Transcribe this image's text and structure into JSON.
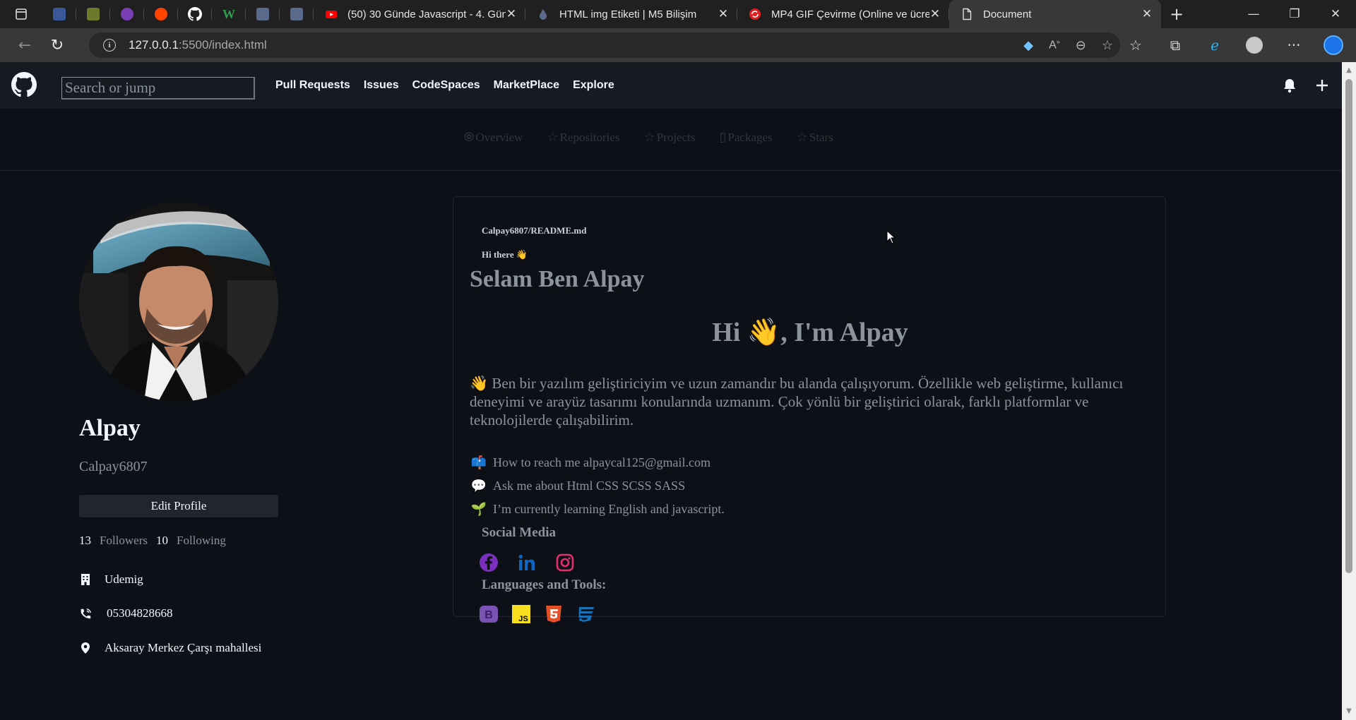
{
  "browser": {
    "tabs": [
      {
        "title": "(50) 30 Günde Javascript - 4. Gün"
      },
      {
        "title": "HTML img Etiketi | M5 Bilişim"
      },
      {
        "title": "MP4 GIF Çevirme (Online ve ücre"
      },
      {
        "title": "Document"
      }
    ],
    "url_host": "127.0.0.1",
    "url_rest": ":5500/index.html"
  },
  "header": {
    "search_placeholder": "Search or jump",
    "nav": [
      "Pull Requests",
      "Issues",
      "CodeSpaces",
      "MarketPlace",
      "Explore"
    ]
  },
  "profile_tabs": [
    "Overview",
    "Repositories",
    "Projects",
    "Packages",
    "Stars"
  ],
  "profile": {
    "name": "Alpay",
    "username": "Calpay6807",
    "edit_label": "Edit Profile",
    "followers_count": "13",
    "followers_label": "Followers",
    "following_count": "10",
    "following_label": "Following",
    "company": "Udemig",
    "phone": "05304828668",
    "location": "Aksaray Merkez Çarşı mahallesi"
  },
  "readme": {
    "path": "Calpay6807/README.md",
    "hi_there": "Hi there",
    "heading1": "Selam Ben Alpay",
    "heading2_pre": "Hi",
    "heading2_post": ", I'm Alpay",
    "paragraph": "Ben bir yazılım geliştiriciyim ve uzun zamandır bu alanda çalışıyorum. Özellikle web geliştirme, kullanıcı deneyimi ve arayüz tasarımı konularında uzmanım. Çok yönlü bir geliştirici olarak, farklı platformlar ve teknolojilerde çalışabilirim.",
    "items": [
      "How to reach me alpaycal125@gmail.com",
      "Ask me about Html CSS SCSS SASS",
      "I’m currently learning English and javascript."
    ],
    "social_title": "Social Media",
    "tools_title": "Languages and Tools:"
  },
  "colors": {
    "bg": "#0d1117",
    "header_bg": "#161b22",
    "facebook": "#7b2fbf",
    "linkedin": "#0a66c2",
    "instagram": "#e1306c",
    "bootstrap": "#7952b3",
    "javascript": "#f7df1e",
    "html5": "#e34f26",
    "css3": "#1572b6"
  }
}
